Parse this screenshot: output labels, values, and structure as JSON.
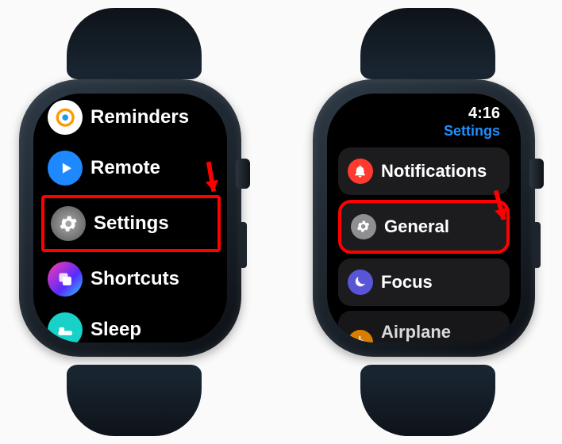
{
  "left": {
    "apps": [
      {
        "label": "Reminders",
        "iconName": "reminders-icon"
      },
      {
        "label": "Remote",
        "iconName": "remote-icon"
      },
      {
        "label": "Settings",
        "iconName": "settings-icon",
        "highlighted": true
      },
      {
        "label": "Shortcuts",
        "iconName": "shortcuts-icon"
      },
      {
        "label": "Sleep",
        "iconName": "sleep-icon"
      }
    ]
  },
  "right": {
    "status": {
      "time": "4:16",
      "title": "Settings"
    },
    "items": [
      {
        "label": "Notifications",
        "iconName": "bell-icon"
      },
      {
        "label": "General",
        "iconName": "gear-icon",
        "highlighted": true
      },
      {
        "label": "Focus",
        "iconName": "moon-icon"
      },
      {
        "label": "Airplane Mode",
        "iconName": "airplane-icon"
      }
    ]
  },
  "annotation": {
    "arrowColor": "#ff0000",
    "highlightColor": "#ff0000"
  }
}
